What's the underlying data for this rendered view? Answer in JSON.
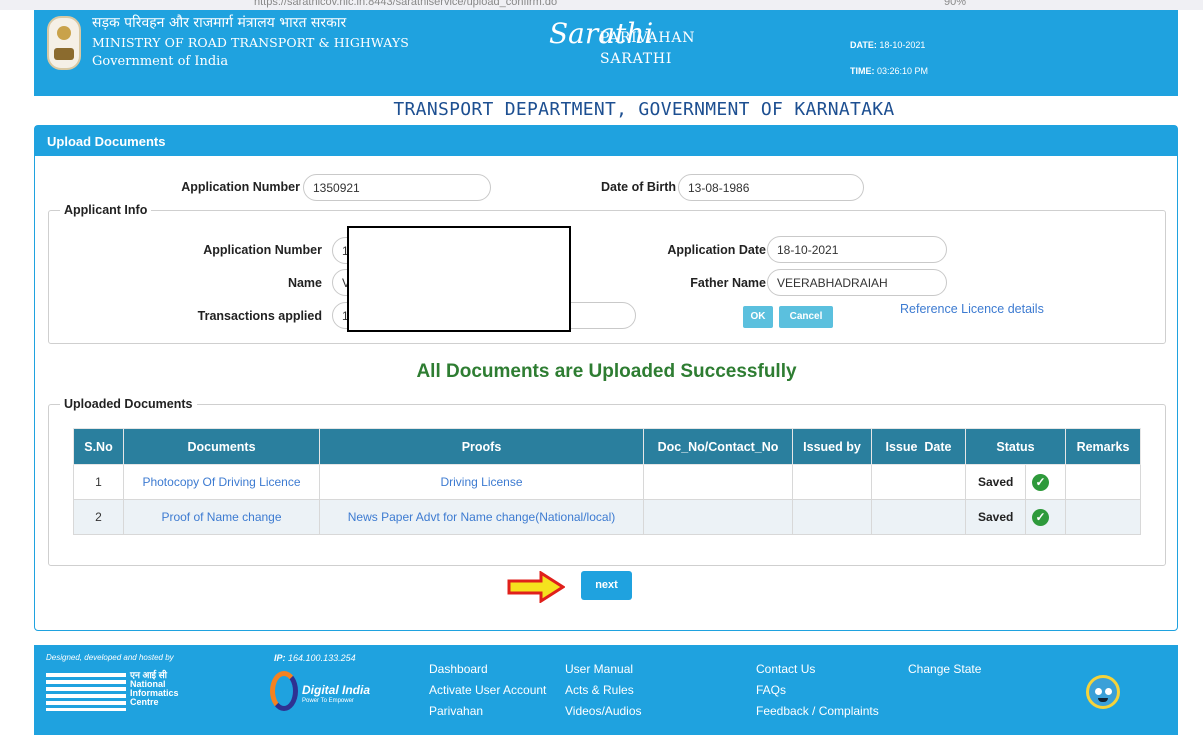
{
  "browser": {
    "url": "https://sarathicov.nic.in:8443/sarathiservice/upload_confirm.do",
    "zoom": "90%"
  },
  "header": {
    "ministry_hindi": "सड़क परिवहन और राजमार्ग मंत्रालय भारत सरकार",
    "ministry_english": "MINISTRY OF ROAD TRANSPORT & HIGHWAYS",
    "government": "Government of India",
    "logo_text": "Sarathi",
    "brand_line1": "PARIVAHAN",
    "brand_line2": "SARATHI",
    "date_label": "DATE:",
    "date_value": "18-10-2021",
    "time_label": "TIME:",
    "time_value": "03:26:10 PM"
  },
  "department_title": "TRANSPORT DEPARTMENT, GOVERNMENT OF KARNATAKA",
  "panel": {
    "title": "Upload Documents",
    "app_number_label": "Application Number",
    "app_number_value": "1350921",
    "dob_label": "Date of Birth",
    "dob_value": "13-08-1986"
  },
  "applicant_info": {
    "legend": "Applicant Info",
    "app_number_label": "Application Number",
    "app_number_value": "1",
    "name_label": "Name",
    "name_value": "V",
    "transactions_label": "Transactions applied",
    "transactions_value": "1",
    "app_date_label": "Application Date",
    "app_date_value": "18-10-2021",
    "father_label": "Father Name",
    "father_value": "VEERABHADRAIAH",
    "ok_label": "OK",
    "cancel_label": "Cancel",
    "ref_link": "Reference Licence details"
  },
  "success_message": "All Documents are Uploaded Successfully",
  "uploaded_documents": {
    "legend": "Uploaded Documents",
    "columns": [
      "S.No",
      "Documents",
      "Proofs",
      "Doc_No/Contact_No",
      "Issued by",
      "Issue  Date",
      "Status",
      "Remarks"
    ],
    "rows": [
      {
        "sno": "1",
        "document": "Photocopy Of Driving Licence",
        "proof": "Driving License",
        "doc_no": "",
        "issued_by": "",
        "issue_date": "",
        "status": "Saved",
        "remarks": ""
      },
      {
        "sno": "2",
        "document": "Proof of Name change",
        "proof": "News Paper Advt for Name change(National/local)",
        "doc_no": "",
        "issued_by": "",
        "issue_date": "",
        "status": "Saved",
        "remarks": ""
      }
    ]
  },
  "next_label": "next",
  "footer": {
    "designed_by": "Designed, developed and hosted by",
    "ip_label": "IP:",
    "ip_value": "164.100.133.254",
    "nic_hindi": "एन आई सी",
    "nic_line1": "National",
    "nic_line2": "Informatics",
    "nic_line3": "Centre",
    "digital_india": "Digital India",
    "digital_india_sub": "Power To Empower",
    "links": {
      "dashboard": "Dashboard",
      "activate": "Activate User Account",
      "parivahan": "Parivahan",
      "user_manual": "User Manual",
      "acts": "Acts & Rules",
      "videos": "Videos/Audios",
      "contact": "Contact Us",
      "faqs": "FAQs",
      "feedback": "Feedback / Complaints",
      "change_state": "Change State"
    }
  },
  "colors": {
    "primary": "#1fa2df",
    "table_header": "#2a7f9e",
    "success": "#2e7d32",
    "link": "#3d7bd1",
    "arrow_fill": "#f5e21e",
    "arrow_stroke": "#e0201b"
  }
}
